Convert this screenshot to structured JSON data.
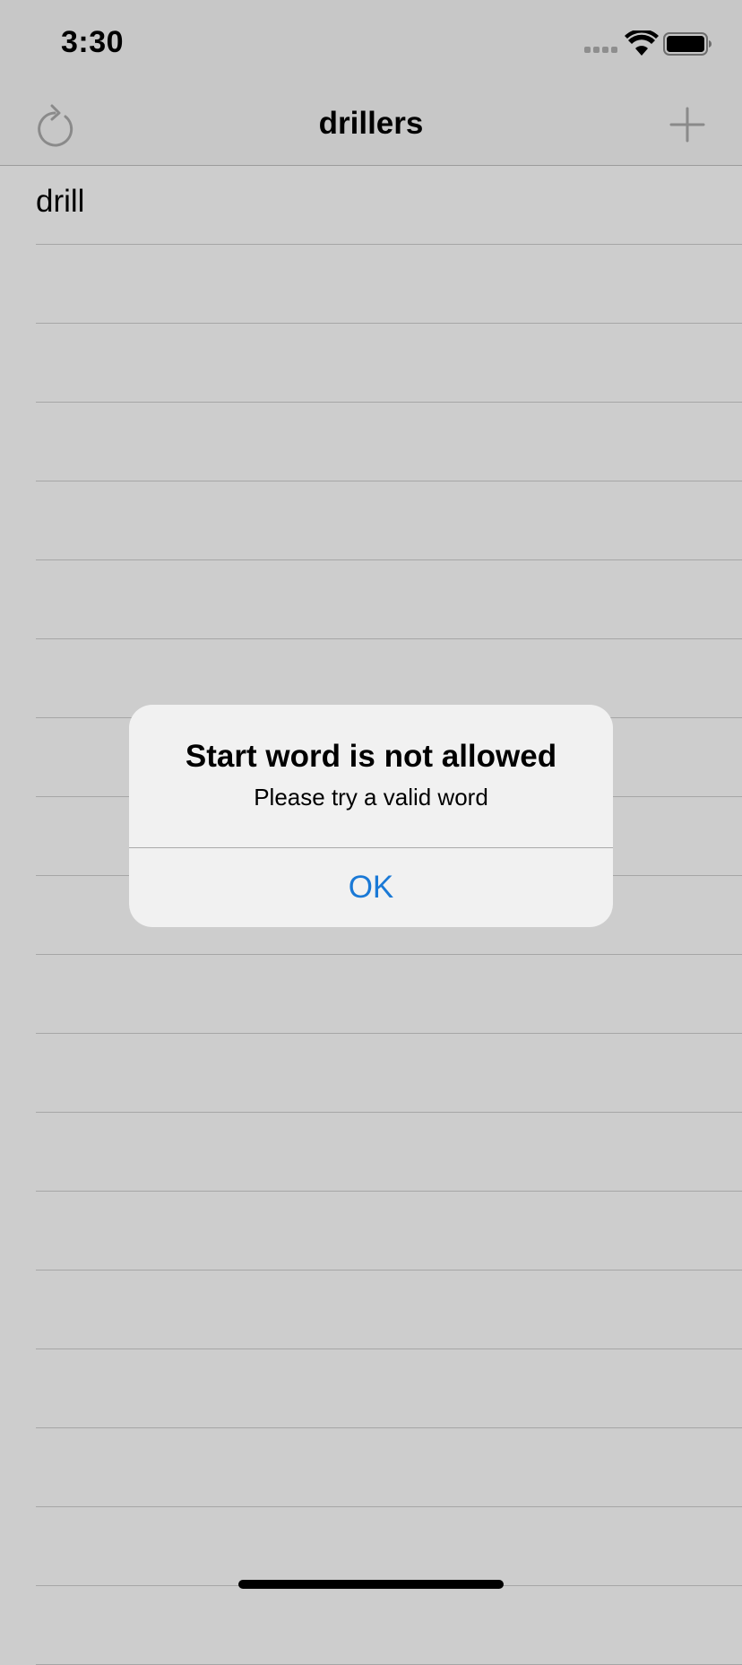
{
  "status_bar": {
    "time": "3:30",
    "icons": [
      "signal-icon",
      "wifi-icon",
      "battery-icon"
    ]
  },
  "nav": {
    "title": "drillers",
    "left_icon": "refresh-icon",
    "right_icon": "plus-icon"
  },
  "list": {
    "rows": [
      "drill",
      "",
      "",
      "",
      "",
      "",
      "",
      "",
      "",
      "",
      "",
      "",
      "",
      "",
      "",
      "",
      "",
      "",
      ""
    ]
  },
  "alert": {
    "title": "Start word is not allowed",
    "message": "Please try a valid word",
    "ok_label": "OK"
  },
  "colors": {
    "background": "#cdcdcd",
    "alert_background": "#f1f1f1",
    "accent": "#1a79d6"
  }
}
